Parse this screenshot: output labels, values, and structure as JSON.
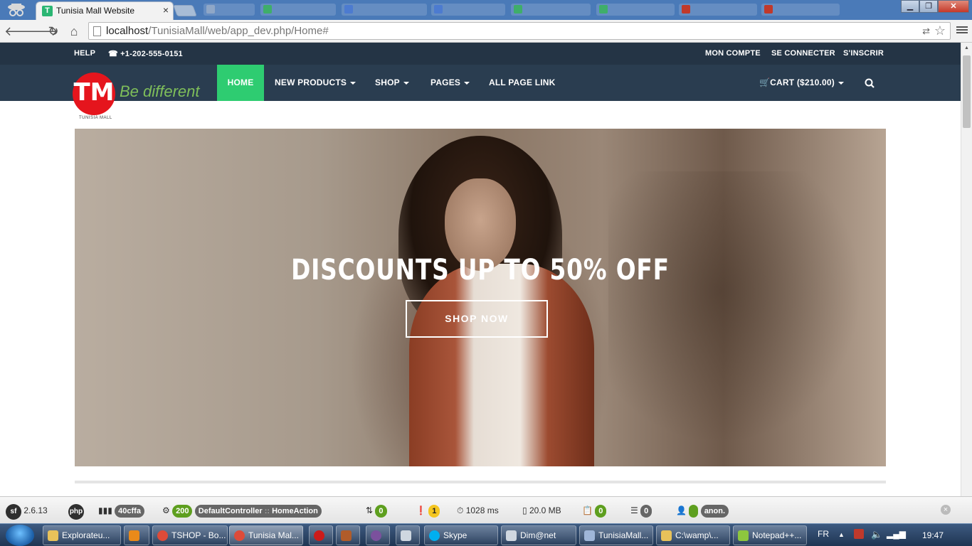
{
  "browser": {
    "active_tab_title": "Tunisia Mall Website",
    "tab_close": "×",
    "url_host": "localhost",
    "url_path": "/TunisiaMall/web/app_dev.php/Home#",
    "window_minimize": "▁",
    "window_maximize": "❐",
    "window_close": "✕"
  },
  "topbar": {
    "help": "HELP",
    "phone": "+1-202-555-0151",
    "account": "MON COMPTE",
    "login": "SE CONNECTER",
    "register": "S'INSCRIR"
  },
  "brand": {
    "logo_text": "TM",
    "logo_caption": "TUNISIA MALL",
    "tagline": "Be different"
  },
  "nav": {
    "home": "HOME",
    "new_products": "NEW PRODUCTS",
    "shop": "SHOP",
    "pages": "PAGES",
    "all_page_link": "ALL PAGE LINK",
    "cart": "CART ($210.00)"
  },
  "hero": {
    "headline": "DISCOUNTS UP TO 50% OFF",
    "cta": "SHOP NOW"
  },
  "symfony_toolbar": {
    "version": "2.6.13",
    "php": "php",
    "token": "40cffa",
    "status": "200",
    "controller": "DefaultController",
    "separator": "::",
    "action": "HomeAction",
    "forms": "0",
    "logs": "1",
    "time": "1028 ms",
    "memory": "20.0 MB",
    "db": "0",
    "queries": "0",
    "user": "anon."
  },
  "taskbar": {
    "items": [
      "Explorateu...",
      "",
      "TSHOP - Bo...",
      "Tunisia Mal...",
      "",
      "",
      "",
      "",
      "Skype",
      "Dim@net",
      "TunisiaMall...",
      "C:\\wamp\\...",
      "Notepad++..."
    ],
    "lang": "FR",
    "clock": "19:47"
  }
}
